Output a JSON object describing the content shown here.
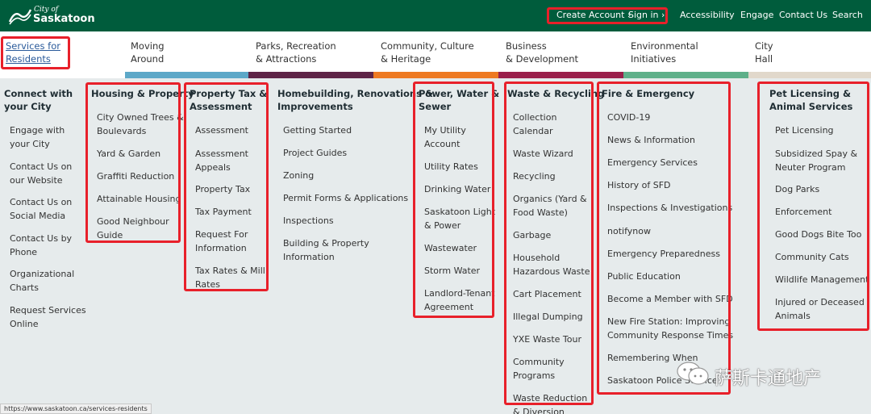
{
  "header": {
    "logo_small": "City of",
    "logo_big": "Saskatoon",
    "create_account": "Create Account ›",
    "sign_in": "Sign in ›",
    "accessibility": "Accessibility",
    "engage": "Engage",
    "contact_us": "Contact Us",
    "search": "Search",
    "colors": {
      "brand_green": "#005c3c",
      "highlight_red": "#e8202a"
    }
  },
  "nav": [
    {
      "label": "Services for\nResidents",
      "active": true,
      "strip_color": "#ffffff"
    },
    {
      "label": "Moving\nAround",
      "active": false,
      "strip_color": "#5da8c8"
    },
    {
      "label": "Parks, Recreation\n& Attractions",
      "active": false,
      "strip_color": "#5e2447"
    },
    {
      "label": "Community, Culture\n& Heritage",
      "active": false,
      "strip_color": "#ee7a22"
    },
    {
      "label": "Business\n& Development",
      "active": false,
      "strip_color": "#9a1f4b"
    },
    {
      "label": "Environmental\nInitiatives",
      "active": false,
      "strip_color": "#5fb08a"
    },
    {
      "label": "City\nHall",
      "active": false,
      "strip_color": "#e1d8cb"
    }
  ],
  "columns": [
    {
      "heading": "Connect with\nyour City",
      "items": [
        "Engage with\nyour City",
        "Contact Us on\nour Website",
        "Contact Us on\nSocial Media",
        "Contact Us by\nPhone",
        "Organizational\nCharts",
        "Request Services\nOnline"
      ]
    },
    {
      "heading": "Housing & Property",
      "items": [
        "City Owned Trees &\nBoulevards",
        "Yard & Garden",
        "Graffiti Reduction",
        "Attainable Housing",
        "Good Neighbour\nGuide"
      ]
    },
    {
      "heading": "Property Tax &\nAssessment",
      "items": [
        "Assessment",
        "Assessment\nAppeals",
        "Property Tax",
        "Tax Payment",
        "Request For\nInformation",
        "Tax Rates & Mill\nRates"
      ]
    },
    {
      "heading": "Homebuilding, Renovations &\nImprovements",
      "items": [
        "Getting Started",
        "Project Guides",
        "Zoning",
        "Permit Forms & Applications",
        "Inspections",
        "Building & Property\nInformation"
      ]
    },
    {
      "heading": "Power, Water &\nSewer",
      "items": [
        "My Utility\nAccount",
        "Utility Rates",
        "Drinking Water",
        "Saskatoon Light\n& Power",
        "Wastewater",
        "Storm Water",
        "Landlord-Tenant\nAgreement"
      ]
    },
    {
      "heading": "Waste & Recycling",
      "items": [
        "Collection\nCalendar",
        "Waste Wizard",
        "Recycling",
        "Organics (Yard &\nFood Waste)",
        "Garbage",
        "Household\nHazardous Waste",
        "Cart Placement",
        "Illegal Dumping",
        "YXE Waste Tour",
        "Community\nPrograms",
        "Waste Reduction\n& Diversion"
      ]
    },
    {
      "heading": "Fire & Emergency",
      "items": [
        "COVID-19",
        "News & Information",
        "Emergency Services",
        "History of SFD",
        "Inspections & Investigations",
        "notifynow",
        "Emergency Preparedness",
        "Public Education",
        "Become a Member with SFD",
        "New Fire Station: Improving\nCommunity Response Times",
        "Remembering When",
        "Saskatoon Police Service"
      ]
    },
    {
      "heading": "Pet Licensing &\nAnimal Services",
      "items": [
        "Pet Licensing",
        "Subsidized Spay &\nNeuter Program",
        "Dog Parks",
        "Enforcement",
        "Good Dogs Bite Too",
        "Community Cats",
        "Wildlife Management",
        "Injured or Deceased\nAnimals"
      ]
    }
  ],
  "status_bar": "https://www.saskatoon.ca/services-residents",
  "watermark": "萨斯卡通地产"
}
